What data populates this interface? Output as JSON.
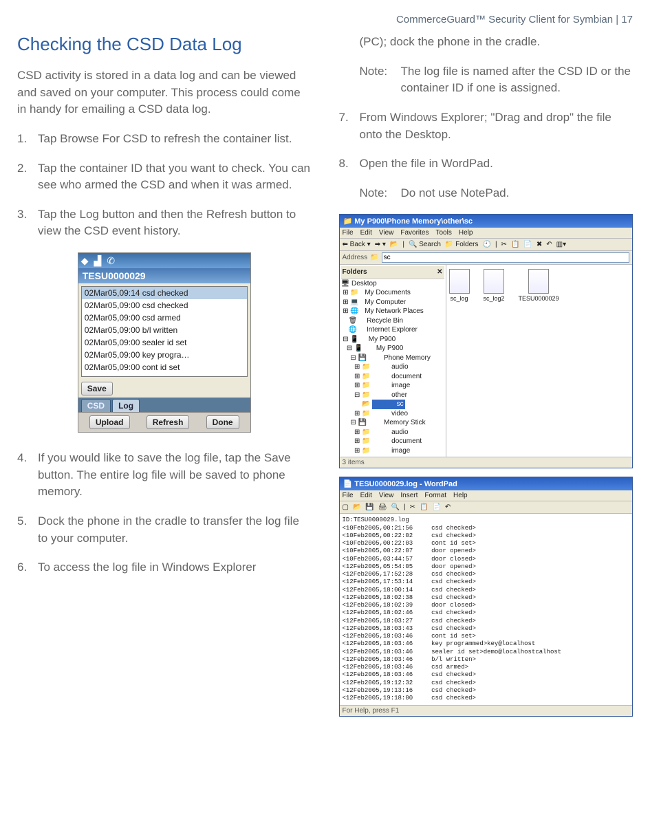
{
  "header": "CommerceGuard™ Security Client for Symbian  |  17",
  "left": {
    "title": "Checking the CSD Data Log",
    "intro": "CSD activity is stored in a data log and can be viewed and saved on your computer. This process could come in handy for emailing a CSD data log.",
    "steps": {
      "s1": "Tap Browse For CSD to refresh the container list.",
      "s2": "Tap the container ID that you want to check. You can see who armed the CSD and when it was armed.",
      "s3": "Tap the Log button and then the Refresh button to view the CSD event history.",
      "s4": "If you would like to save the log file, tap the Save button. The entire log file will be saved to phone memory.",
      "s5": "Dock the phone in the cradle to transfer the log file to your computer.",
      "s6": "To access the log file in Windows Explorer"
    },
    "phone": {
      "title": "TESU0000029",
      "rows": [
        "02Mar05,09:14 csd checked",
        "02Mar05,09:00 csd checked",
        "02Mar05,09:00 csd armed",
        "02Mar05,09:00 b/l written",
        "02Mar05,09:00 sealer id set",
        "02Mar05,09:00 key progra…",
        "02Mar05,09:00 cont id set"
      ],
      "save": "Save",
      "tab_csd": "CSD",
      "tab_log": "Log",
      "btn_upload": "Upload",
      "btn_refresh": "Refresh",
      "btn_done": "Done"
    }
  },
  "right": {
    "cont6": "(PC); dock the phone in the cradle.",
    "note1_label": "Note:",
    "note1_text": "The log file is named after the CSD ID or the container ID if one is assigned.",
    "s7": "From Windows Explorer; \"Drag and drop\" the file onto the Desktop.",
    "s8": "Open the file in WordPad.",
    "note2_label": "Note:",
    "note2_text": "Do not use NotePad.",
    "explorer": {
      "title": "My P900\\Phone Memory\\other\\sc",
      "menu": [
        "File",
        "Edit",
        "View",
        "Favorites",
        "Tools",
        "Help"
      ],
      "back": "Back",
      "search": "Search",
      "folders_btn": "Folders",
      "addr_label": "Address",
      "addr_value": "sc",
      "folders_hdr": "Folders",
      "tree": [
        "Desktop",
        "  My Documents",
        "  My Computer",
        "  My Network Places",
        "    Recycle Bin",
        "    Internet Explorer",
        "    My P900",
        "      My P900",
        "        Phone Memory",
        "          audio",
        "          document",
        "          image",
        "          other",
        "            sc",
        "          video",
        "        Memory Stick",
        "          audio",
        "          document",
        "          image"
      ],
      "files": [
        "sc_log",
        "sc_log2",
        "TESU0000029"
      ],
      "status": "3 items"
    },
    "wordpad": {
      "title": "TESU0000029.log - WordPad",
      "menu": [
        "File",
        "Edit",
        "View",
        "Insert",
        "Format",
        "Help"
      ],
      "lines": [
        "ID:TESU0000029.log",
        "<10Feb2005,00:21:56     csd checked>",
        "<10Feb2005,00:22:02     csd checked>",
        "<10Feb2005,00:22:03     cont id set>",
        "<10Feb2005,00:22:07     door opened>",
        "<10Feb2005,03:44:57     door closed>",
        "<12Feb2005,05:54:05     door opened>",
        "<12Feb2005,17:52:28     csd checked>",
        "<12Feb2005,17:53:14     csd checked>",
        "<12Feb2005,18:00:14     csd checked>",
        "<12Feb2005,18:02:38     csd checked>",
        "<12Feb2005,18:02:39     door closed>",
        "<12Feb2005,18:02:46     csd checked>",
        "<12Feb2005,18:03:27     csd checked>",
        "<12Feb2005,18:03:43     csd checked>",
        "<12Feb2005,18:03:46     cont id set>",
        "<12Feb2005,18:03:46     key programmed>key@localhost",
        "<12Feb2005,18:03:46     sealer id set>demo@localhostcalhost",
        "<12Feb2005,18:03:46     b/l written>",
        "<12Feb2005,18:03:46     csd armed>",
        "<12Feb2005,18:03:46     csd checked>",
        "<12Feb2005,19:12:32     csd checked>",
        "<12Feb2005,19:13:16     csd checked>",
        "<12Feb2005,19:18:00     csd checked>"
      ],
      "status": "For Help, press F1"
    }
  }
}
